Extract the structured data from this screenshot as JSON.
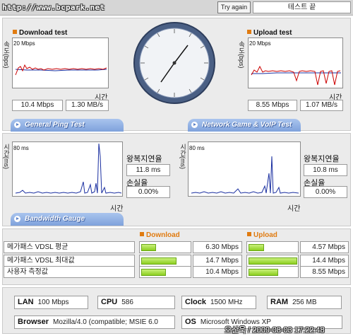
{
  "header": {
    "url": "http://www.bcpark.net",
    "try_again": "Try again",
    "test_end": "테스트 끝"
  },
  "download": {
    "title": "Download test",
    "ylabel": "속도(bps)",
    "scale": "20 Mbps",
    "xlabel": "시간",
    "value_mbps": "10.4 Mbps",
    "value_mbs": "1.30 MB/s"
  },
  "upload": {
    "title": "Upload test",
    "ylabel": "속도(bps)",
    "scale": "20 Mbps",
    "xlabel": "시간",
    "value_mbps": "8.55 Mbps",
    "value_mbs": "1.07 MB/s"
  },
  "tabs": {
    "ping": "General Ping Test",
    "game": "Network Game & VoIP Test",
    "bandwidth": "Bandwidth Gauge"
  },
  "ping": {
    "ylabel": "시간(ms)",
    "scale": "80 ms",
    "xlabel": "시간",
    "rtt_label": "왕복지연율",
    "rtt_value": "11.8 ms",
    "loss_label": "손실율",
    "loss_value": "0.00%"
  },
  "game": {
    "ylabel": "시간(ms)",
    "scale": "80 ms",
    "xlabel": "시간",
    "rtt_label": "왕복지연율",
    "rtt_value": "10.8 ms",
    "loss_label": "손실율",
    "loss_value": "0.00%"
  },
  "bandwidth": {
    "download_head": "Download",
    "upload_head": "Upload",
    "rows": [
      {
        "label": "메가패스 VDSL 평균",
        "down": "6.30 Mbps",
        "down_level": 0.3,
        "up": "4.57 Mbps",
        "up_level": 0.32
      },
      {
        "label": "메가패스 VDSL 최대값",
        "down": "14.7 Mbps",
        "down_level": 0.72,
        "up": "14.4 Mbps",
        "up_level": 0.98
      },
      {
        "label": "사용자 측정값",
        "down": "10.4 Mbps",
        "down_level": 0.5,
        "up": "8.55 Mbps",
        "up_level": 0.6
      }
    ]
  },
  "info": {
    "lan_label": "LAN",
    "lan": "100 Mbps",
    "cpu_label": "CPU",
    "cpu": "586",
    "clock_label": "Clock",
    "clock": "1500 MHz",
    "ram_label": "RAM",
    "ram": "256 MB",
    "browser_label": "Browser",
    "browser": "Mozilla/4.0 (compatible; MSIE 6.0",
    "os_label": "OS",
    "os": "Microsoft Windows XP"
  },
  "watermark": "오산욱 / 2009-08-03 17:22:48",
  "colors": {
    "accent_orange": "#e07b10",
    "download_line": "#cc0000",
    "baseline_blue": "#1a2fa0",
    "bar_green": "#8ccf20",
    "tab_blue": "#7fa2dc"
  }
}
